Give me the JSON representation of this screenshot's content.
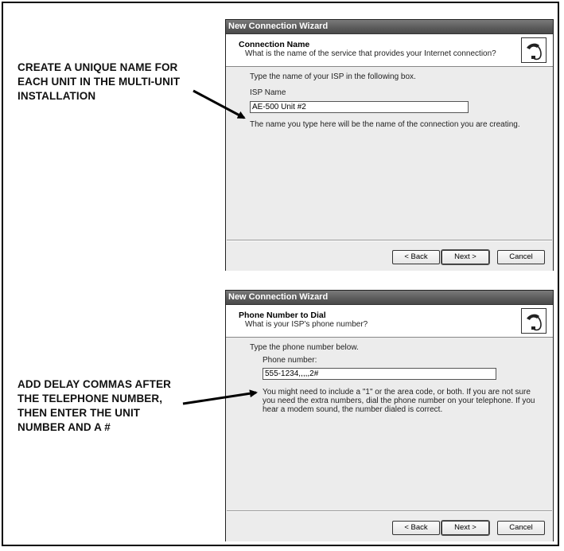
{
  "callouts": {
    "top": [
      "CREATE A UNIQUE NAME FOR",
      "EACH UNIT IN THE MULTI-UNIT",
      "INSTALLATION"
    ],
    "bottom": [
      "ADD DELAY COMMAS AFTER",
      "THE TELEPHONE NUMBER,",
      "THEN ENTER THE UNIT",
      "NUMBER AND A #"
    ]
  },
  "dialog1": {
    "title": "New Connection Wizard",
    "header_title": "Connection Name",
    "header_sub": "What is the name of the service that provides your Internet connection?",
    "instruction": "Type the name of your ISP in the following box.",
    "field_label": "ISP Name",
    "field_value": "AE-500 Unit #2",
    "note": "The name you type here will be the name of the connection you are creating.",
    "back": "< Back",
    "next": "Next >",
    "cancel": "Cancel",
    "logo_icon": "phone-cable-icon"
  },
  "dialog2": {
    "title": "New Connection Wizard",
    "header_title": "Phone Number to Dial",
    "header_sub": "What is your ISP's phone number?",
    "instruction": "Type the phone number below.",
    "field_label": "Phone number:",
    "field_value": "555-1234,,,,,2#",
    "note_lines": [
      "You might need to include a \"1\" or the area code, or both. If you are not sure",
      "you need the extra numbers, dial the phone number on your telephone. If you",
      "hear a modem sound, the number dialed is correct."
    ],
    "back": "< Back",
    "next": "Next >",
    "cancel": "Cancel",
    "logo_icon": "phone-cable-icon"
  }
}
